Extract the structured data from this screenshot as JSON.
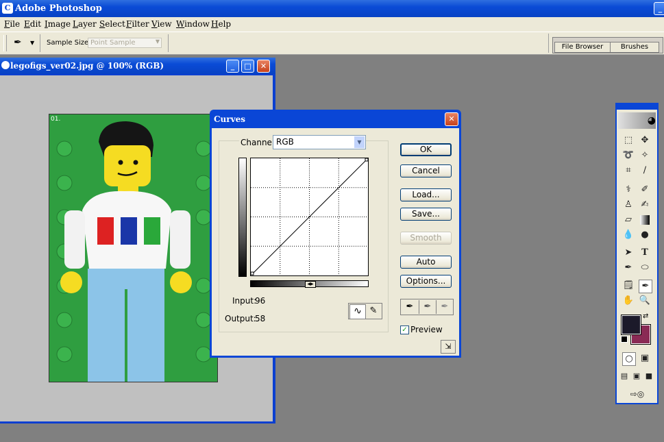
{
  "app": {
    "title": "Adobe Photoshop"
  },
  "menu": [
    "File",
    "Edit",
    "Image",
    "Layer",
    "Select",
    "Filter",
    "View",
    "Window",
    "Help"
  ],
  "options_bar": {
    "sample_size_label": "Sample Size:",
    "sample_size_value": "Point Sample"
  },
  "palette_well": {
    "tabs": [
      "File Browser",
      "Brushes"
    ]
  },
  "document": {
    "title": "legofigs_ver02.jpg @ 100% (RGB)",
    "badge": "01."
  },
  "curves": {
    "title": "Curves",
    "channel_label": "Channel:",
    "channel_value": "RGB",
    "input_label": "Input:",
    "input_value": "96",
    "output_label": "Output:",
    "output_value": "58",
    "buttons": {
      "ok": "OK",
      "cancel": "Cancel",
      "load": "Load...",
      "save": "Save...",
      "smooth": "Smooth",
      "auto": "Auto",
      "options": "Options..."
    },
    "preview_label": "Preview",
    "preview_checked": true
  },
  "toolbox": {
    "tools": [
      "marquee-icon",
      "move-icon",
      "lasso-icon",
      "magic-wand-icon",
      "crop-icon",
      "slice-icon",
      "healing-brush-icon",
      "brush-icon",
      "stamp-icon",
      "history-brush-icon",
      "eraser-icon",
      "gradient-icon",
      "blur-icon",
      "dodge-icon",
      "path-select-icon",
      "type-icon",
      "pen-icon",
      "shape-icon",
      "notes-icon",
      "eyedropper-icon",
      "hand-icon",
      "zoom-icon"
    ],
    "foreground_color": "#1c1a2a",
    "background_color": "#8a2a55"
  }
}
